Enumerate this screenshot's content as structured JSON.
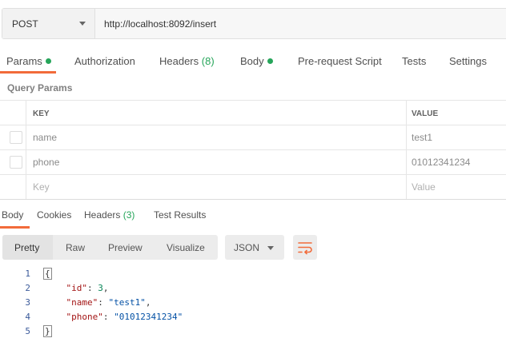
{
  "request": {
    "method": "POST",
    "url": "http://localhost:8092/insert"
  },
  "request_tabs": [
    {
      "label": "Params",
      "dot": true,
      "active": true
    },
    {
      "label": "Authorization"
    },
    {
      "label": "Headers",
      "count": "(8)"
    },
    {
      "label": "Body",
      "dot": true
    },
    {
      "label": "Pre-request Script"
    },
    {
      "label": "Tests"
    },
    {
      "label": "Settings"
    }
  ],
  "query_params": {
    "title": "Query Params",
    "header": {
      "key": "KEY",
      "value": "VALUE"
    },
    "rows": [
      {
        "key": "name",
        "value": "test1"
      },
      {
        "key": "phone",
        "value": "01012341234"
      }
    ],
    "placeholder": {
      "key": "Key",
      "value": "Value"
    }
  },
  "response_tabs": [
    {
      "label": "Body",
      "active": true
    },
    {
      "label": "Cookies"
    },
    {
      "label": "Headers",
      "count": "(3)"
    },
    {
      "label": "Test Results"
    }
  ],
  "view_modes": [
    "Pretty",
    "Raw",
    "Preview",
    "Visualize"
  ],
  "format": "JSON",
  "code": {
    "line_numbers": [
      "1",
      "2",
      "3",
      "4",
      "5"
    ],
    "open_brace": "{",
    "close_brace": "}",
    "fields": [
      {
        "key": "\"id\"",
        "sep": ": ",
        "value": "3",
        "trail": ","
      },
      {
        "key": "\"name\"",
        "sep": ": ",
        "value": "\"test1\"",
        "trail": ","
      },
      {
        "key": "\"phone\"",
        "sep": ": ",
        "value": "\"01012341234\"",
        "trail": ""
      }
    ]
  },
  "colors": {
    "accent": "#f26b3a",
    "dot": "#26a55a"
  }
}
